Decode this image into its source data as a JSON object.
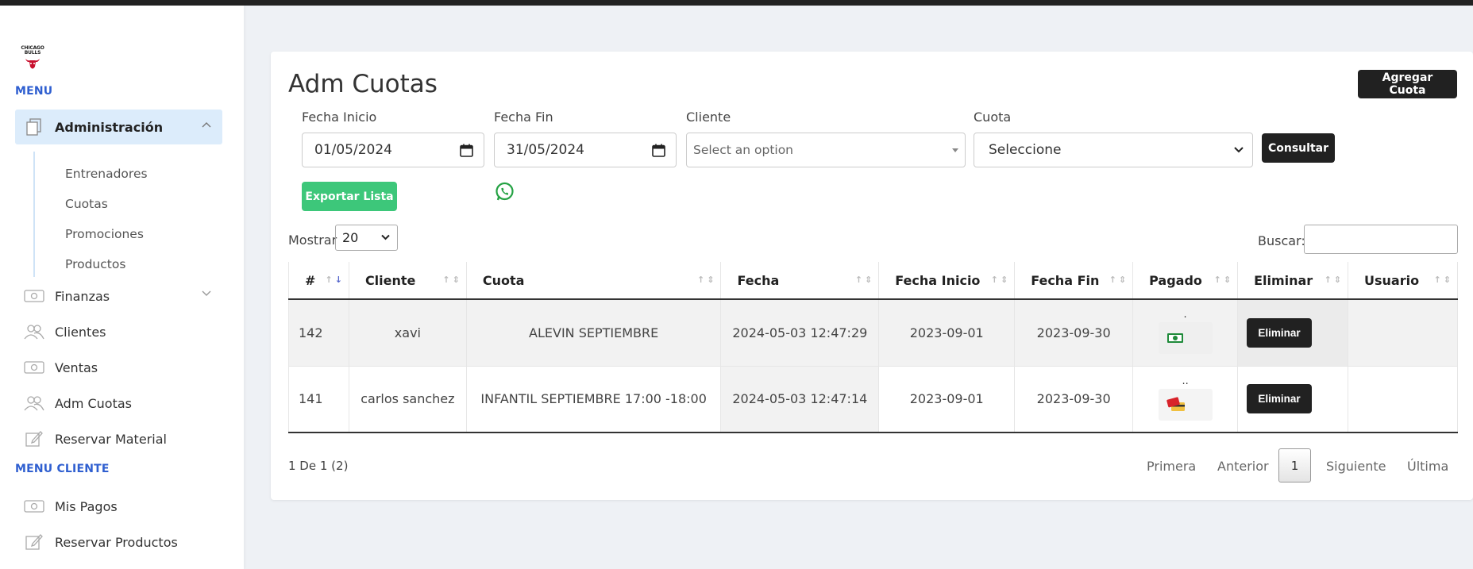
{
  "sidebar": {
    "logo_text": [
      "CHICAGO",
      "BULLS"
    ],
    "menu_heading": "MENU",
    "items": [
      {
        "label": "Administración",
        "icon": "document-copy-icon",
        "active": true
      },
      {
        "label": "Finanzas",
        "icon": "money-icon"
      },
      {
        "label": "Clientes",
        "icon": "users-icon"
      },
      {
        "label": "Ventas",
        "icon": "money-icon"
      },
      {
        "label": "Adm Cuotas",
        "icon": "users-icon"
      },
      {
        "label": "Reservar Material",
        "icon": "edit-icon"
      }
    ],
    "subitems": [
      "Entrenadores",
      "Cuotas",
      "Promociones",
      "Productos"
    ],
    "client_heading": "MENU CLIENTE",
    "client_items": [
      {
        "label": "Mis Pagos",
        "icon": "money-icon"
      },
      {
        "label": "Reservar Productos",
        "icon": "edit-icon"
      }
    ]
  },
  "main": {
    "title": "Adm Cuotas",
    "add_button": "Agregar Cuota",
    "filters": {
      "fecha_inicio_label": "Fecha Inicio",
      "fecha_inicio_value": "01/05/2024",
      "fecha_fin_label": "Fecha Fin",
      "fecha_fin_value": "31/05/2024",
      "cliente_label": "Cliente",
      "cliente_placeholder": "Select an option",
      "cuota_label": "Cuota",
      "cuota_value": "Seleccione",
      "consultar_button": "Consultar"
    },
    "export_button": "Exportar Lista",
    "show_label": "Mostrar",
    "show_value": "20",
    "search_label": "Buscar:",
    "table": {
      "headers": [
        "#",
        "Cliente",
        "Cuota",
        "Fecha",
        "Fecha Inicio",
        "Fecha Fin",
        "Pagado",
        "Eliminar",
        "Usuario"
      ],
      "rows": [
        {
          "id": "142",
          "cliente": "xavi",
          "cuota": "ALEVIN SEPTIEMBRE",
          "fecha": "2024-05-03 12:47:29",
          "inicio": "2023-09-01",
          "fin": "2023-09-30",
          "pagado_mark": ".",
          "pagado_icon": "cash-icon",
          "eliminar": "Eliminar",
          "usuario": ""
        },
        {
          "id": "141",
          "cliente": "carlos sanchez",
          "cuota": "INFANTIL SEPTIEMBRE 17:00 -18:00",
          "fecha": "2024-05-03 12:47:14",
          "inicio": "2023-09-01",
          "fin": "2023-09-30",
          "pagado_mark": "..",
          "pagado_icon": "credit-card-icon",
          "eliminar": "Eliminar",
          "usuario": ""
        }
      ]
    },
    "footer_info": "1 De 1 (2)",
    "pager": {
      "first": "Primera",
      "prev": "Anterior",
      "current": "1",
      "next": "Siguiente",
      "last": "Última"
    }
  },
  "colors": {
    "accent_blue": "#2f5fd0",
    "active_bg": "#dcecfb",
    "dark_button": "#212121",
    "export_green": "#3dc77a",
    "whatsapp_green": "#25a244"
  }
}
